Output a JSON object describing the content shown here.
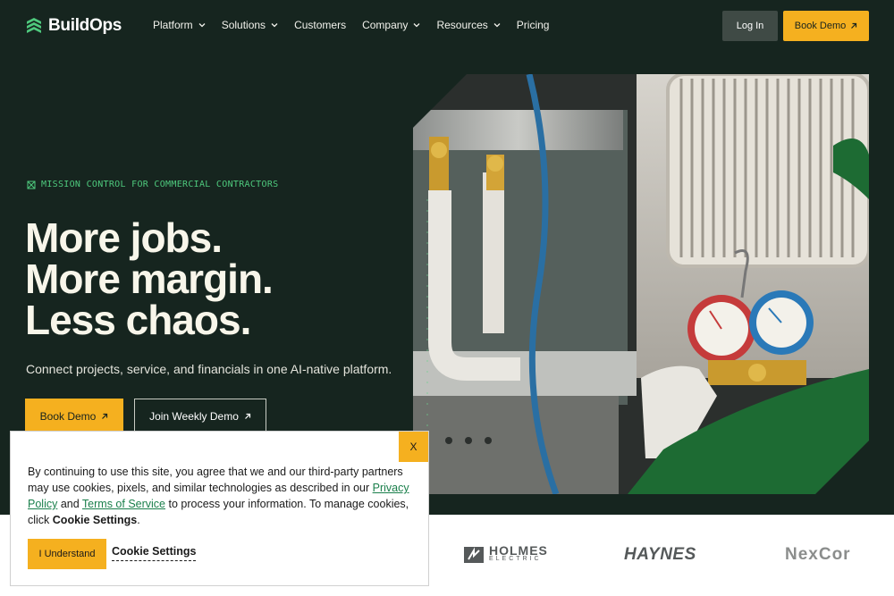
{
  "brand": {
    "name": "BuildOps",
    "accent": "#f5b01f",
    "green": "#4ec97d",
    "bg": "#16251f"
  },
  "nav": {
    "items": [
      {
        "label": "Platform",
        "dropdown": true
      },
      {
        "label": "Solutions",
        "dropdown": true
      },
      {
        "label": "Customers",
        "dropdown": false
      },
      {
        "label": "Company",
        "dropdown": true
      },
      {
        "label": "Resources",
        "dropdown": true
      },
      {
        "label": "Pricing",
        "dropdown": false
      }
    ],
    "login_label": "Log In",
    "book_demo_label": "Book Demo"
  },
  "hero": {
    "eyebrow": "MISSION CONTROL FOR COMMERCIAL CONTRACTORS",
    "headline": [
      "More jobs.",
      "More margin.",
      "Less chaos."
    ],
    "subhead": "Connect projects, service, and financials in one AI-native platform.",
    "primary_cta": "Book Demo",
    "secondary_cta": "Join Weekly Demo",
    "image_alt": "Technician gauges on HVAC unit"
  },
  "customer_logos": [
    "HOLMES",
    "ELECTRIC",
    "HAYNES",
    "NexCor"
  ],
  "cookie_banner": {
    "close_label": "X",
    "text_1": "By continuing to use this site, you agree that we and our third-party partners may use cookies, pixels, and similar technologies as described in our ",
    "privacy_link": "Privacy Policy",
    "text_2": " and ",
    "terms_link": "Terms of Service",
    "text_3": " to process your information. To manage cookies, click ",
    "settings_bold": "Cookie Settings",
    "text_4": ".",
    "accept_label": "I Understand",
    "settings_label": "Cookie Settings"
  }
}
